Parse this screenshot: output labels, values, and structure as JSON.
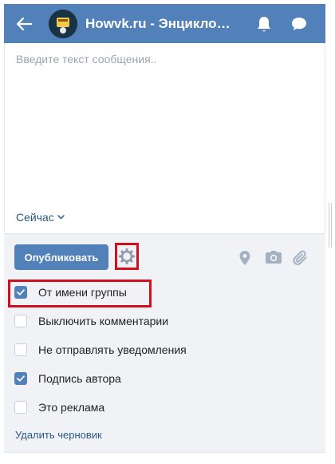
{
  "header": {
    "title": "Howvk.ru - Энциклопедия ВКонтакте",
    "back_icon": "arrow-left-icon",
    "notifications_icon": "bell-icon",
    "messages_icon": "chat-bubble-icon",
    "background_color": "#5181b8"
  },
  "composer": {
    "placeholder": "Введите текст сообщения..",
    "timing_label": "Сейчас"
  },
  "toolbar": {
    "publish_label": "Опубликовать",
    "settings_icon": "gear-icon",
    "attachments": [
      "location-pin-icon",
      "camera-icon",
      "paperclip-icon"
    ]
  },
  "options": [
    {
      "label": "От имени группы",
      "checked": true
    },
    {
      "label": "Выключить комментарии",
      "checked": false
    },
    {
      "label": "Не отправлять уведомления",
      "checked": false
    },
    {
      "label": "Подпись автора",
      "checked": true
    },
    {
      "label": "Это реклама",
      "checked": false
    }
  ],
  "delete_draft_label": "Удалить черновик",
  "colors": {
    "accent": "#5181b8",
    "link": "#2a5885",
    "highlight": "#d0101f",
    "panel": "#f0f2f5"
  }
}
